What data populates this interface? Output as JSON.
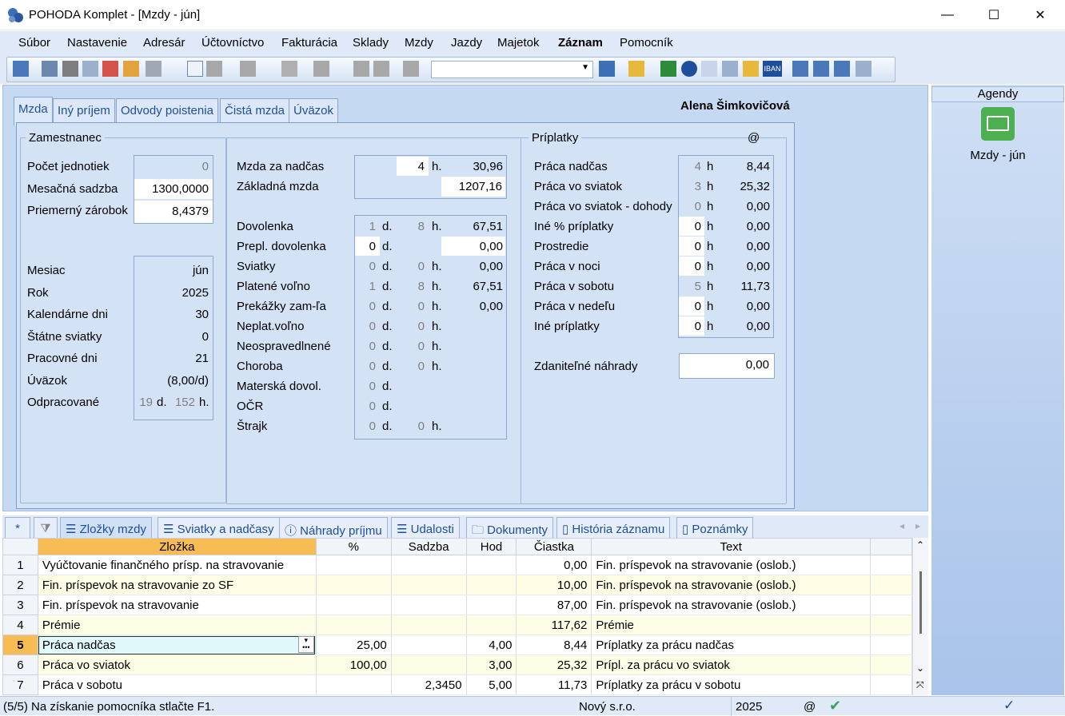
{
  "window": {
    "title": "POHODA Komplet - [Mzdy - jún]",
    "min": "—",
    "max": "☐",
    "close": "✕"
  },
  "menu": [
    "Súbor",
    "Nastavenie",
    "Adresár",
    "Účtovníctvo",
    "Fakturácia",
    "Sklady",
    "Mzdy",
    "Jazdy",
    "Majetok",
    "Záznam",
    "Pomocník"
  ],
  "tabs": [
    "Mzda",
    "Iný príjem",
    "Odvody poistenia",
    "Čistá mzda",
    "Úväzok"
  ],
  "employee_name": "Alena Šimkovičová",
  "zamestnanec": {
    "legend": "Zamestnanec",
    "pocet_label": "Počet jednotiek",
    "pocet_val": "0",
    "sadzba_label": "Mesačná sadzba",
    "sadzba_val": "1300,0000",
    "zarobok_label": "Priemerný zárobok",
    "zarobok_val": "8,4379",
    "mesiac_label": "Mesiac",
    "mesiac_val": "jún",
    "rok_label": "Rok",
    "rok_val": "2025",
    "kal_label": "Kalendárne dni",
    "kal_val": "30",
    "sviatky_label": "Štátne sviatky",
    "sviatky_val": "0",
    "prac_label": "Pracovné dni",
    "prac_val": "21",
    "uvazok_label": "Úväzok",
    "uvazok_val": "(8,00/d)",
    "odprac_label": "Odpracované",
    "odprac_d": "19",
    "odprac_h": "152",
    "d_unit": "d.",
    "h_unit": "h."
  },
  "mzda": {
    "nadcas_label": "Mzda za nadčas",
    "nadcas_h": "4",
    "nadcas_unit": "h.",
    "nadcas_val": "30,96",
    "zakl_label": "Základná mzda",
    "zakl_val": "1207,16",
    "rows": [
      {
        "label": "Dovolenka",
        "d": "1",
        "h": "8",
        "val": "67,51"
      },
      {
        "label": "Prepl. dovolenka",
        "d": "0",
        "h": "",
        "val": "0,00"
      },
      {
        "label": "Sviatky",
        "d": "0",
        "h": "0",
        "val": "0,00"
      },
      {
        "label": "Platené voľno",
        "d": "1",
        "h": "8",
        "val": "67,51"
      },
      {
        "label": "Prekážky zam-ľa",
        "d": "0",
        "h": "0",
        "val": "0,00"
      },
      {
        "label": "Neplat.voľno",
        "d": "0",
        "h": "0",
        "val": ""
      },
      {
        "label": "Neospravedlnené",
        "d": "0",
        "h": "0",
        "val": ""
      },
      {
        "label": "Choroba",
        "d": "0",
        "h": "0",
        "val": ""
      },
      {
        "label": "Materská dovol.",
        "d": "0",
        "h": "",
        "val": ""
      },
      {
        "label": "OČR",
        "d": "0",
        "h": "",
        "val": ""
      },
      {
        "label": "Štrajk",
        "d": "0",
        "h": "0",
        "val": ""
      }
    ],
    "d_unit": "d.",
    "h_unit": "h."
  },
  "priplatky": {
    "legend": "Príplatky",
    "at": "@",
    "h_unit": "h",
    "rows": [
      {
        "label": "Práca nadčas",
        "h": "4",
        "val": "8,44"
      },
      {
        "label": "Práca vo sviatok",
        "h": "3",
        "val": "25,32"
      },
      {
        "label": "Práca vo sviatok - dohody",
        "h": "0",
        "val": "0,00"
      },
      {
        "label": "Iné % príplatky",
        "h": "0",
        "val": "0,00"
      },
      {
        "label": "Prostredie",
        "h": "0",
        "val": "0,00"
      },
      {
        "label": "Práca v noci",
        "h": "0",
        "val": "0,00"
      },
      {
        "label": "Práca v sobotu",
        "h": "5",
        "val": "11,73"
      },
      {
        "label": "Práca v nedeľu",
        "h": "0",
        "val": "0,00"
      },
      {
        "label": "Iné príplatky",
        "h": "0",
        "val": "0,00"
      }
    ],
    "zdan_label": "Zdaniteľné náhrady",
    "zdan_val": "0,00"
  },
  "agendy": {
    "header": "Agendy",
    "item": "Mzdy - jún"
  },
  "bottom_tabs": [
    "Zložky mzdy",
    "Sviatky a nadčasy",
    "Náhrady príjmu",
    "Udalosti",
    "Dokumenty",
    "História záznamu",
    "Poznámky"
  ],
  "grid": {
    "columns": [
      "Zložka",
      "%",
      "Sadzba",
      "Hod",
      "Čiastka",
      "Text"
    ],
    "rows": [
      {
        "n": "1",
        "zlozka": "Vyúčtovanie finančného prísp. na stravovanie",
        "pct": "",
        "sadzba": "",
        "hod": "",
        "ciastka": "0,00",
        "text": "Fin. príspevok na stravovanie (oslob.)"
      },
      {
        "n": "2",
        "zlozka": "Fin. príspevok na stravovanie zo SF",
        "pct": "",
        "sadzba": "",
        "hod": "",
        "ciastka": "10,00",
        "text": "Fin. príspevok na stravovanie (oslob.)"
      },
      {
        "n": "3",
        "zlozka": "Fin. príspevok na stravovanie",
        "pct": "",
        "sadzba": "",
        "hod": "",
        "ciastka": "87,00",
        "text": "Fin. príspevok na stravovanie (oslob.)"
      },
      {
        "n": "4",
        "zlozka": "Prémie",
        "pct": "",
        "sadzba": "",
        "hod": "",
        "ciastka": "117,62",
        "text": "Prémie"
      },
      {
        "n": "5",
        "zlozka": "Práca nadčas",
        "pct": "25,00",
        "sadzba": "",
        "hod": "4,00",
        "ciastka": "8,44",
        "text": "Príplatky za prácu nadčas"
      },
      {
        "n": "6",
        "zlozka": "Práca vo sviatok",
        "pct": "100,00",
        "sadzba": "",
        "hod": "3,00",
        "ciastka": "25,32",
        "text": "Prípl. za prácu vo sviatok"
      },
      {
        "n": "7",
        "zlozka": "Práca v sobotu",
        "pct": "",
        "sadzba": "2,3450",
        "hod": "5,00",
        "ciastka": "11,73",
        "text": "Príplatky za prácu v sobotu"
      }
    ]
  },
  "status": {
    "text": "(5/5) Na získanie pomocníka stlačte F1.",
    "company": "Nový s.r.o.",
    "year": "2025",
    "at": "@"
  }
}
